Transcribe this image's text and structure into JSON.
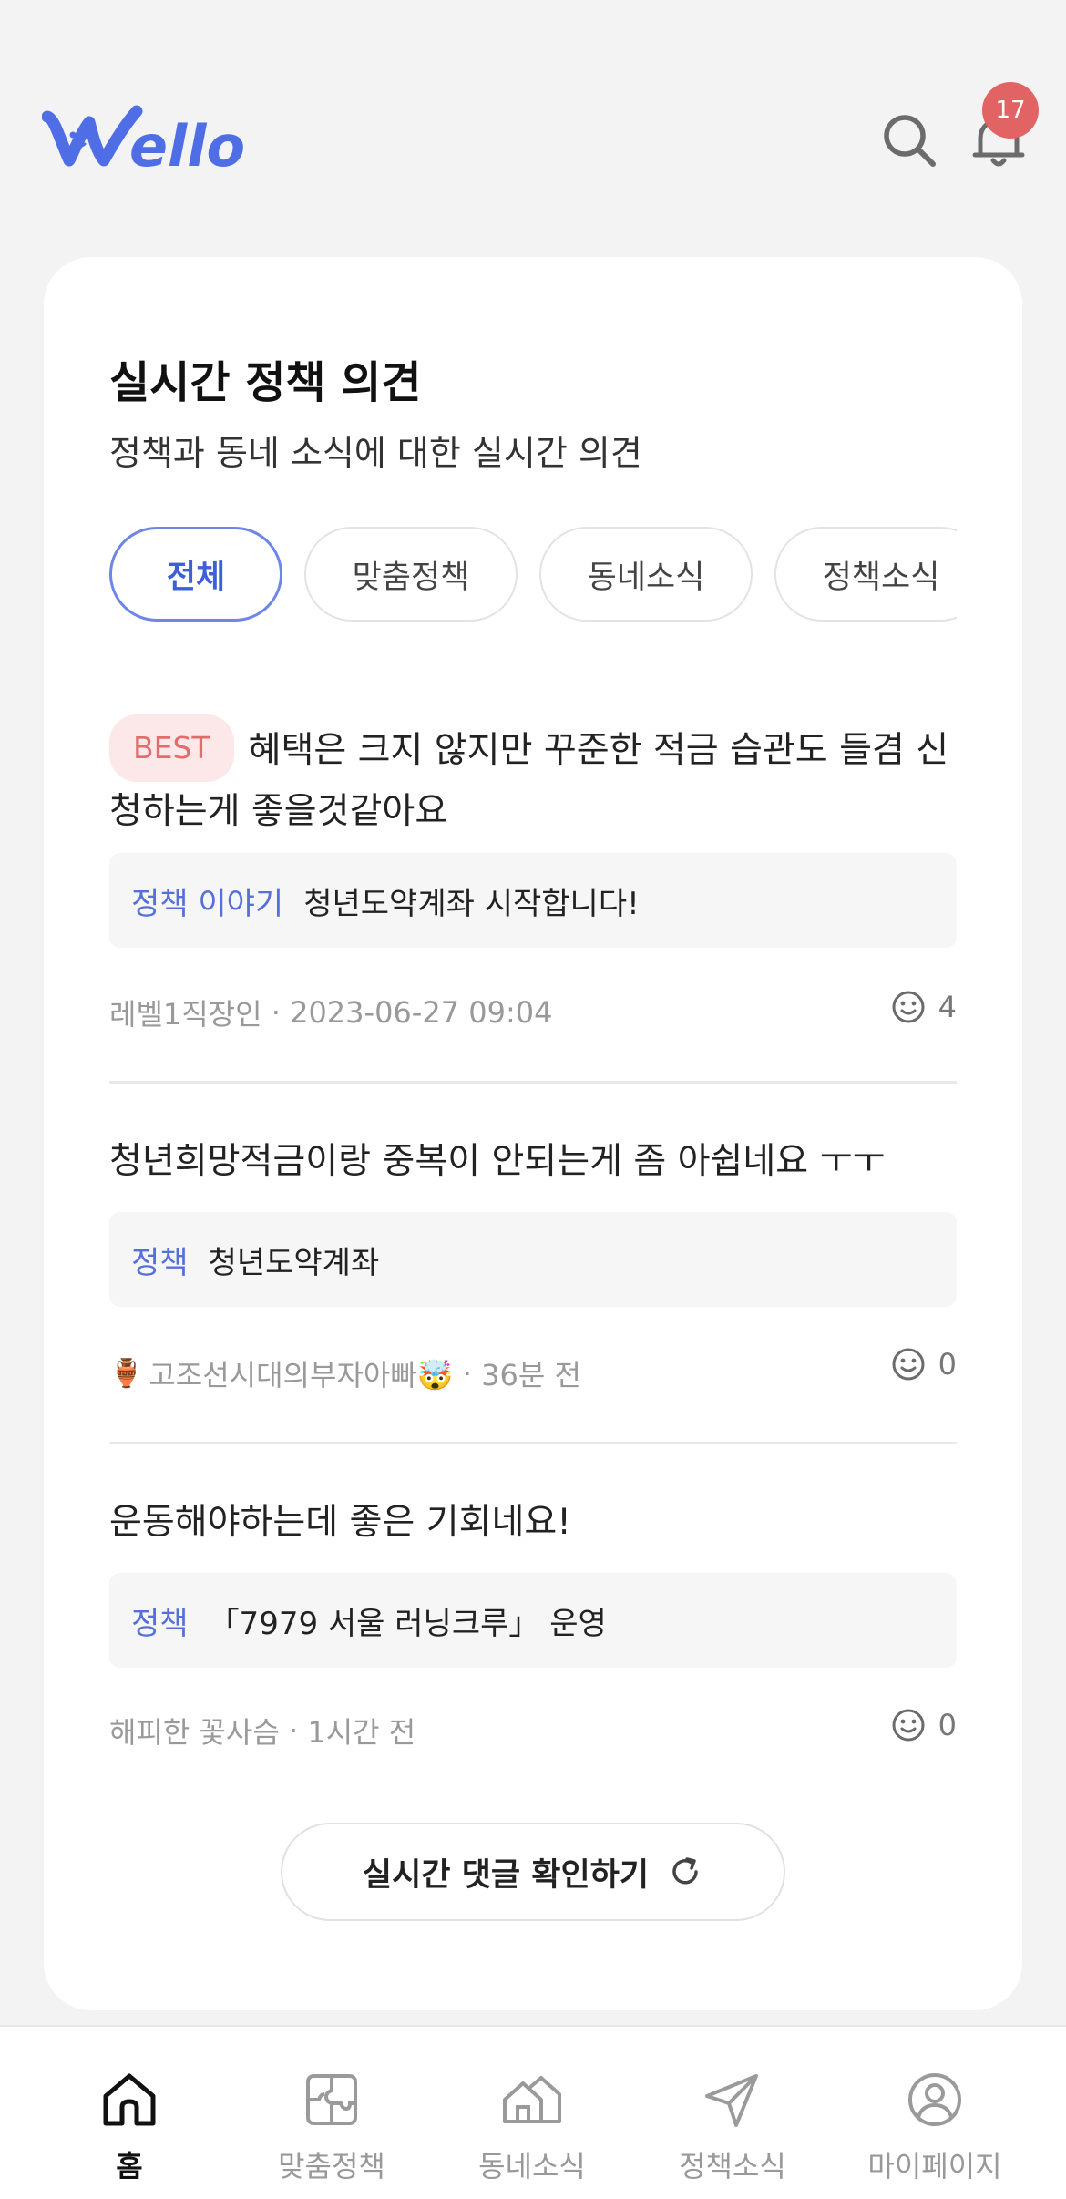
{
  "header": {
    "logo_text": "Wello",
    "notification_count": "17"
  },
  "section": {
    "title": "실시간 정책 의견",
    "subtitle": "정책과 동네 소식에 대한 실시간 의견",
    "tabs": [
      {
        "label": "전체",
        "active": true
      },
      {
        "label": "맞춤정책",
        "active": false
      },
      {
        "label": "동네소식",
        "active": false
      },
      {
        "label": "정책소식",
        "active": false
      }
    ]
  },
  "comments": [
    {
      "badge": "BEST",
      "text": "혜택은 크지 않지만 꾸준한 적금 습관도 들겸 신청하는게 좋을것같아요",
      "ref_tag": "정책 이야기",
      "ref_title": "청년도약계좌 시작합니다!",
      "author": "레벨1직장인",
      "time": "2023-06-27 09:04",
      "reactions": "4"
    },
    {
      "text": "청년희망적금이랑 중복이 안되는게 좀 아쉽네요 ㅜㅜ",
      "ref_tag": "정책",
      "ref_title": "청년도약계좌",
      "author_emoji": "🏺",
      "author": "고조선시대의부자아빠🤯",
      "time": "36분 전",
      "reactions": "0"
    },
    {
      "text": "운동해야하는데 좋은 기회네요!",
      "ref_tag": "정책",
      "ref_title": "「7979 서울 러닝크루」 운영",
      "author": "해피한 꽃사슴",
      "time": "1시간 전",
      "reactions": "0"
    }
  ],
  "refresh_button": {
    "label": "실시간 댓글 확인하기"
  },
  "bottom_nav": [
    {
      "label": "홈",
      "icon": "home-icon",
      "active": true
    },
    {
      "label": "맞춤정책",
      "icon": "puzzle-icon",
      "active": false
    },
    {
      "label": "동네소식",
      "icon": "houses-icon",
      "active": false
    },
    {
      "label": "정책소식",
      "icon": "send-icon",
      "active": false
    },
    {
      "label": "마이페이지",
      "icon": "user-icon",
      "active": false
    }
  ],
  "colors": {
    "brand": "#4f6ee6",
    "badge": "#e26363",
    "best_bg": "#fce8e8",
    "best_text": "#e06d6d"
  }
}
